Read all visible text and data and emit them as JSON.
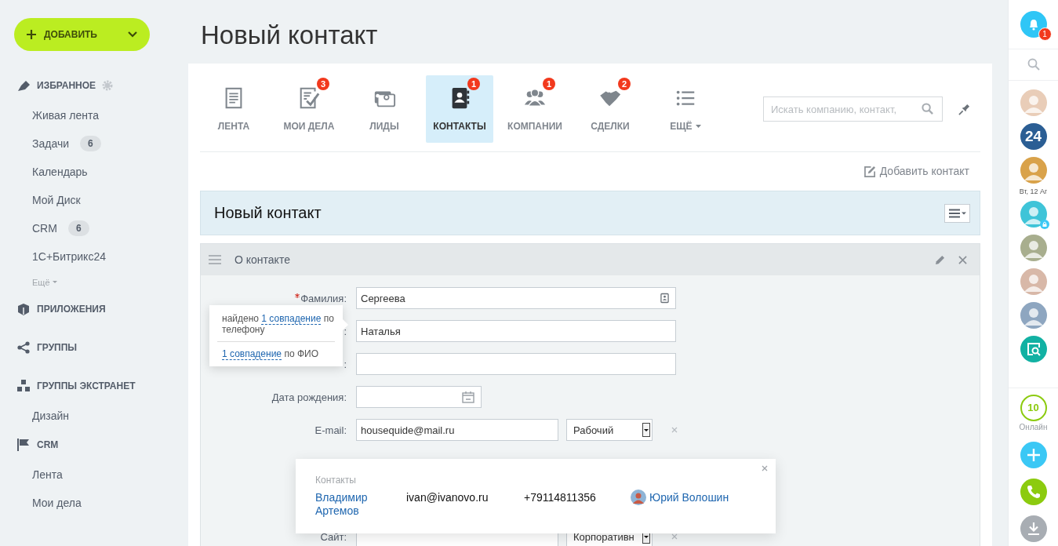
{
  "add_button": {
    "label": "ДОБАВИТЬ"
  },
  "sidebar": {
    "sections": [
      {
        "title": "ИЗБРАННОЕ",
        "settings": true,
        "items": [
          {
            "label": "Живая лента"
          },
          {
            "label": "Задачи",
            "counter": "6"
          },
          {
            "label": "Календарь"
          },
          {
            "label": "Мой Диск"
          },
          {
            "label": "CRM",
            "counter": "6"
          },
          {
            "label": "1С+Битрикс24"
          }
        ],
        "more": "Ещё"
      },
      {
        "title": "ПРИЛОЖЕНИЯ",
        "settings": false
      },
      {
        "title": "ГРУППЫ",
        "settings": false
      },
      {
        "title": "ГРУППЫ ЭКСТРАНЕТ",
        "settings": false,
        "items": [
          {
            "label": "Дизайн"
          }
        ]
      },
      {
        "title": "CRM",
        "settings": false,
        "items": [
          {
            "label": "Лента"
          },
          {
            "label": "Мои дела"
          }
        ]
      }
    ]
  },
  "page_title": "Новый контакт",
  "tabs": [
    {
      "label": "ЛЕНТА",
      "selected": false,
      "dropdown": false
    },
    {
      "label": "МОИ ДЕЛА",
      "counter": "3",
      "selected": false,
      "dropdown": false
    },
    {
      "label": "ЛИДЫ",
      "selected": false,
      "dropdown": false
    },
    {
      "label": "КОНТАКТЫ",
      "counter": "1",
      "selected": true,
      "dropdown": false
    },
    {
      "label": "КОМПАНИИ",
      "counter": "1",
      "selected": false,
      "dropdown": false
    },
    {
      "label": "СДЕЛКИ",
      "counter": "2",
      "selected": false,
      "dropdown": false
    },
    {
      "label": "ЕЩЁ",
      "selected": false,
      "dropdown": true
    }
  ],
  "search": {
    "placeholder": "Искать компанию, контакт,"
  },
  "add_contact": "Добавить контакт",
  "card": {
    "title": "Новый контакт",
    "section": {
      "title": "О контакте",
      "fields": [
        {
          "kind": "lookup",
          "label": "Фамилия:",
          "required": true,
          "value": "Сергеева"
        },
        {
          "kind": "text",
          "label": ":",
          "required": false,
          "value": "Наталья"
        },
        {
          "kind": "text",
          "label": ":",
          "required": false
        },
        {
          "kind": "date",
          "label": "Дата рождения:",
          "required": false
        },
        {
          "kind": "multi",
          "label": "E-mail:",
          "required": false,
          "value": "housequide@mail.ru",
          "type": "Рабочий"
        },
        {
          "kind": "multi",
          "label": "Сайт:",
          "required": false,
          "type": "Корпоративн"
        }
      ]
    }
  },
  "duplicate_hint": {
    "lines": [
      {
        "before": "найдено",
        "link": "1 совпадение",
        "after": "по телефону"
      },
      {
        "link": "1 совпадение",
        "after": "по ФИО"
      }
    ]
  },
  "contacts_popup": {
    "heading": "Контакты",
    "rows": [
      {
        "name": "Владимир Артемов",
        "email": "ivan@ivanovo.ru",
        "phone": "+79114811356",
        "responsible": "Юрий Волошин"
      }
    ]
  },
  "right_bar": {
    "notifications": "1",
    "items": [
      {
        "kind": "avatar",
        "color": "#e9cdb8",
        "locked": false
      },
      {
        "kind": "logo",
        "text": "24"
      },
      {
        "kind": "avatar",
        "color": "#d9a24a",
        "locked": false
      },
      {
        "kind": "date",
        "text": "Вт, 12 Аг"
      },
      {
        "kind": "avatar",
        "color": "#3fc4d8",
        "locked": true
      },
      {
        "kind": "avatar",
        "color": "#a8ae8e",
        "locked": false
      },
      {
        "kind": "avatar",
        "color": "#d8b8a8",
        "locked": false
      },
      {
        "kind": "avatar",
        "color": "#8ea6c0",
        "locked": false
      },
      {
        "kind": "app"
      }
    ],
    "online": {
      "count": "10",
      "label": "Онлайн"
    }
  }
}
